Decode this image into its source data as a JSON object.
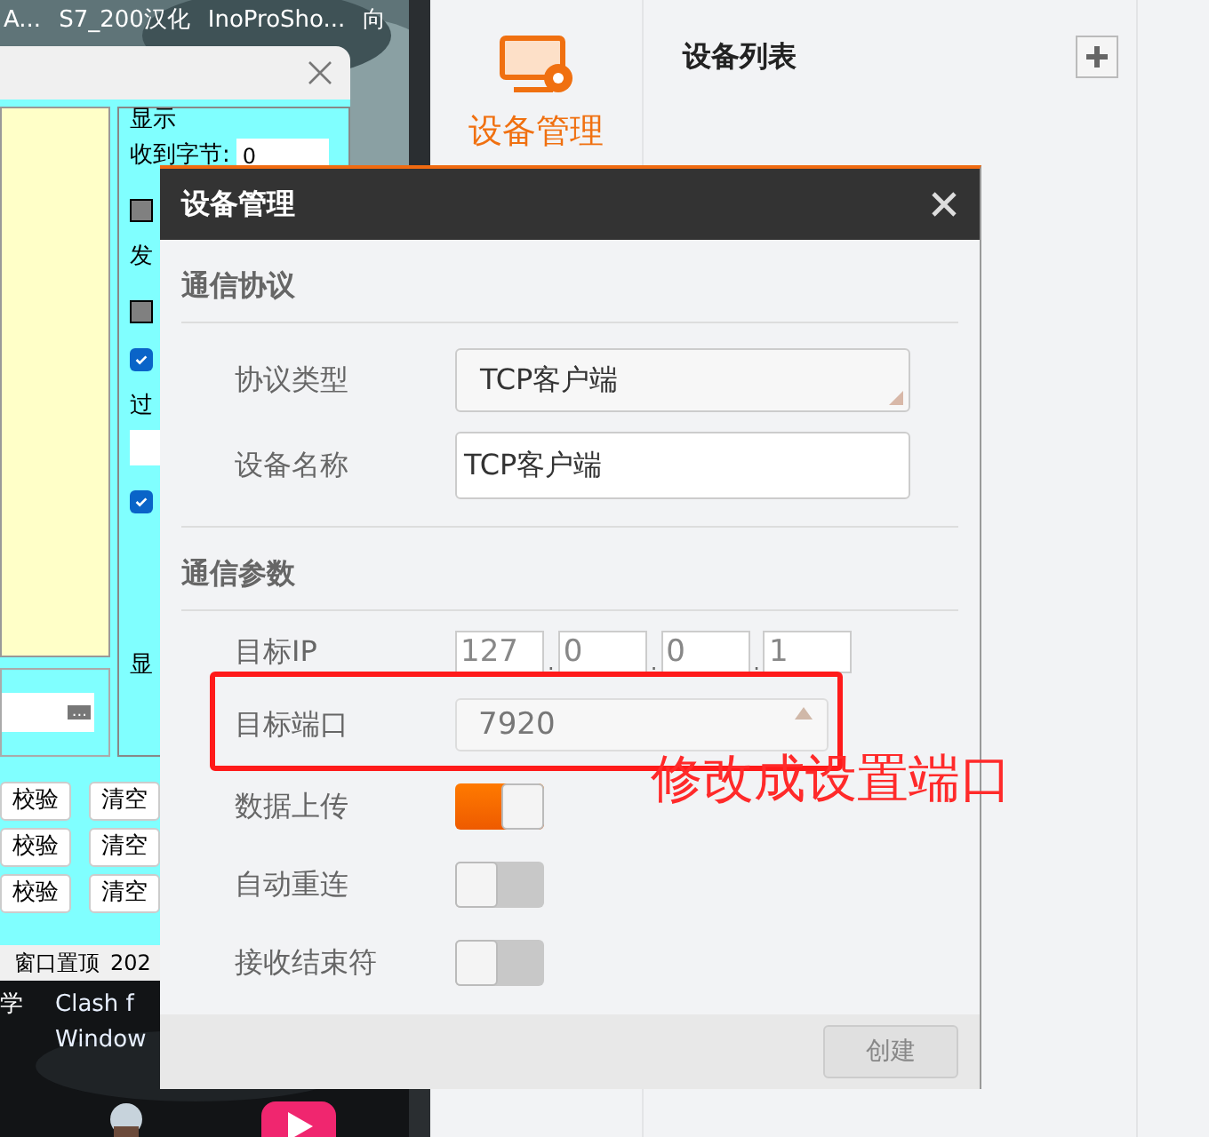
{
  "desktop": {
    "taskbar_labels": [
      "A...",
      "S7_200汉化",
      "InoProSho...",
      "向"
    ],
    "icon_labels": [
      "学",
      "Clash f",
      "Window"
    ]
  },
  "serial_window": {
    "panel_title": "显示",
    "received_label": "收到字节:",
    "received_value": "0",
    "panel_items": [
      {
        "kind": "checkbox",
        "checked": false
      },
      {
        "kind": "label",
        "text": "发"
      },
      {
        "kind": "checkbox",
        "checked": false
      },
      {
        "kind": "checkbox",
        "checked": true
      },
      {
        "kind": "label",
        "text": "过"
      },
      {
        "kind": "field"
      },
      {
        "kind": "checkbox",
        "checked": true
      }
    ],
    "panel_footer": "显",
    "browse_button": "...",
    "button_rows": [
      [
        "校验",
        "清空"
      ],
      [
        "校验",
        "清空"
      ],
      [
        "校验",
        "清空"
      ]
    ],
    "status_bar": [
      "窗口置顶",
      "202"
    ]
  },
  "app": {
    "sidebar_items": [
      {
        "label": "设备管理",
        "selected": true
      }
    ],
    "list_title": "设备列表"
  },
  "dialog": {
    "title": "设备管理",
    "sections": [
      {
        "title": "通信协议",
        "fields": [
          {
            "kind": "select",
            "label": "协议类型",
            "value": "TCP客户端"
          },
          {
            "kind": "text",
            "label": "设备名称",
            "value": "TCP客户端"
          }
        ]
      },
      {
        "title": "通信参数",
        "fields": [
          {
            "kind": "ip",
            "label": "目标IP",
            "separator": ".",
            "octets": [
              "127",
              "0",
              "0",
              "1"
            ]
          },
          {
            "kind": "number",
            "label": "目标端口",
            "value": "7920"
          },
          {
            "kind": "switch",
            "label": "数据上传",
            "on": true
          },
          {
            "kind": "switch",
            "label": "自动重连",
            "on": false
          },
          {
            "kind": "switch",
            "label": "接收结束符",
            "on": false
          }
        ]
      }
    ],
    "create_button": {
      "label": "创建",
      "disabled": true
    }
  },
  "annotation": {
    "text": "修改成设置端口"
  }
}
